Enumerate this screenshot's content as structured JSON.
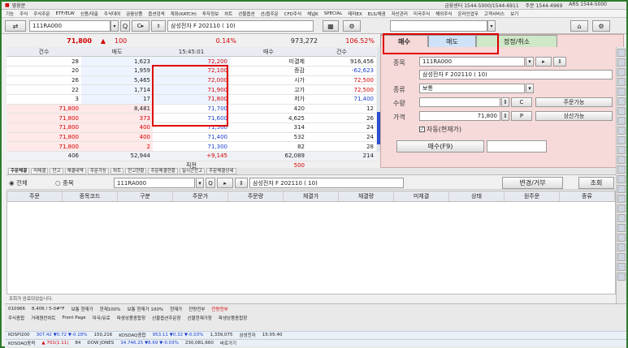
{
  "window": {
    "title": "영웅문",
    "info": [
      "금융센터 1544-5000/1544-6911",
      "주문 1544-4969",
      "ARS 1544-5000"
    ]
  },
  "menu": [
    "기능",
    "주식",
    "주식주문",
    "ETF/ELW",
    "신용/대출",
    "주식대여",
    "금융상품",
    "옵션검색",
    "계좌(KATCH)",
    "투자정보",
    "차트",
    "선물옵션",
    "선/옵주문",
    "CFD주식",
    "채널K",
    "SPECIAL",
    "테마EX",
    "ELS/채권",
    "자산관리",
    "미국주식",
    "해외주식",
    "온라인업무",
    "고객서비스",
    "보기"
  ],
  "toolbar": {
    "code": "111RA000",
    "name": "삼성전자  F 202110 ( 10)"
  },
  "quote": {
    "price": "71,800",
    "arrow": "▲",
    "change": "100",
    "change_pct": "0.14%",
    "volume": "973,272",
    "pct2": "106.52%"
  },
  "orderbook": {
    "headers": [
      "건수",
      "매도",
      "15:45:01",
      "매수",
      "건수"
    ],
    "asks": [
      {
        "count": "28",
        "qty": "1,623",
        "price": "72,200"
      },
      {
        "count": "20",
        "qty": "1,959",
        "price": "72,100"
      },
      {
        "count": "26",
        "qty": "5,465",
        "price": "72,000"
      },
      {
        "count": "22",
        "qty": "1,714",
        "price": "71,900"
      },
      {
        "count": "3",
        "qty": "17",
        "price": "71,800"
      }
    ],
    "bids": [
      {
        "price": "71,700",
        "qty": "420",
        "count": "12"
      },
      {
        "price": "71,600",
        "qty": "4,625",
        "count": "26"
      },
      {
        "price": "71,500",
        "qty": "314",
        "count": "24"
      },
      {
        "price": "71,400",
        "qty": "532",
        "count": "24"
      },
      {
        "price": "71,300",
        "qty": "82",
        "count": "28"
      }
    ],
    "stats": [
      {
        "label": "미결제",
        "value": "916,456"
      },
      {
        "label": "증감",
        "value": "-62,623"
      },
      {
        "label": "시가",
        "value": "72,500"
      },
      {
        "label": "고가",
        "value": "72,500"
      },
      {
        "label": "저가",
        "value": "71,400"
      }
    ],
    "executed": [
      {
        "price": "71,800",
        "qty": "8,481"
      },
      {
        "price": "71,800",
        "qty": "373"
      },
      {
        "price": "71,800",
        "qty": "400"
      },
      {
        "price": "71,800",
        "qty": "400"
      },
      {
        "price": "71,800",
        "qty": "2"
      }
    ],
    "totals": {
      "ask_count": "406",
      "ask_qty": "52,944",
      "diff": "+9,145",
      "bid_qty": "62,089",
      "bid_count": "214"
    },
    "direct": {
      "label": "직전",
      "value": "500"
    }
  },
  "order": {
    "tabs": [
      "매수",
      "매도",
      "정정/취소"
    ],
    "label_item": "종목",
    "item_code": "111RA000",
    "item_name": "삼성전자  F 202110 ( 10)",
    "label_type": "종류",
    "type_value": "보통",
    "label_qty": "수량",
    "qty_btn": "C",
    "qty_avail": "주문가능",
    "label_price": "가격",
    "price_value": "71,800",
    "price_btn": "P",
    "settle": "상산가능",
    "auto": "자동(현재가)",
    "submit": "매수(F9)"
  },
  "lower": {
    "tabs": [
      "주문체결",
      "미체결",
      "잔고",
      "체결내역",
      "주문가능",
      "차트",
      "잔고현황",
      "주문체결현황",
      "실시간잔고",
      "주문체결상세"
    ],
    "filter_all": "전체",
    "filter_item": "종목",
    "code": "111RA000",
    "name": "삼성전자  F 202110 ( 10)",
    "modify_btn": "변경/거부",
    "query_btn": "조회",
    "columns": [
      "주문",
      "종목코드",
      "구분",
      "주문가",
      "주문량",
      "체결가",
      "체결량",
      "미체결",
      "상태",
      "원주문",
      "종류"
    ]
  },
  "status": "조회가 완료되었습니다.",
  "bottom": {
    "row1": [
      "010966",
      "8,406 / 5-0#*F",
      "보통  현재가",
      "현재100%",
      "보통  현재가  100%",
      "현재가",
      "잔량전부",
      "잔량전부"
    ],
    "row2": [
      "주식종합",
      "거래원찬차트",
      "Front Page",
      "미국/유로",
      "파생상품종합창",
      "선물옵션주문창",
      "선물현재가창",
      "파생상품종합창"
    ],
    "row3": [
      "KOSPI200",
      "307.42  ▼0.72  ▼-0.18%",
      "150,216",
      "KOSDAQ종합",
      "953.11  ▼0.32  ▼-0.03%",
      "1,339,075",
      "삼성전자",
      "15:05:40"
    ],
    "row4": [
      "KOSDAQ동락",
      "▲ 701(1.11)",
      "84",
      "DOW JONES",
      "34,746.25  ▼8.69  ▼-0.03%",
      "230,081,660",
      "바로가기"
    ]
  },
  "colors": {
    "ask": "#d40000",
    "bid": "#1a3fd0",
    "order_bg": "#f6d9d9",
    "highlight": "#e00000"
  }
}
